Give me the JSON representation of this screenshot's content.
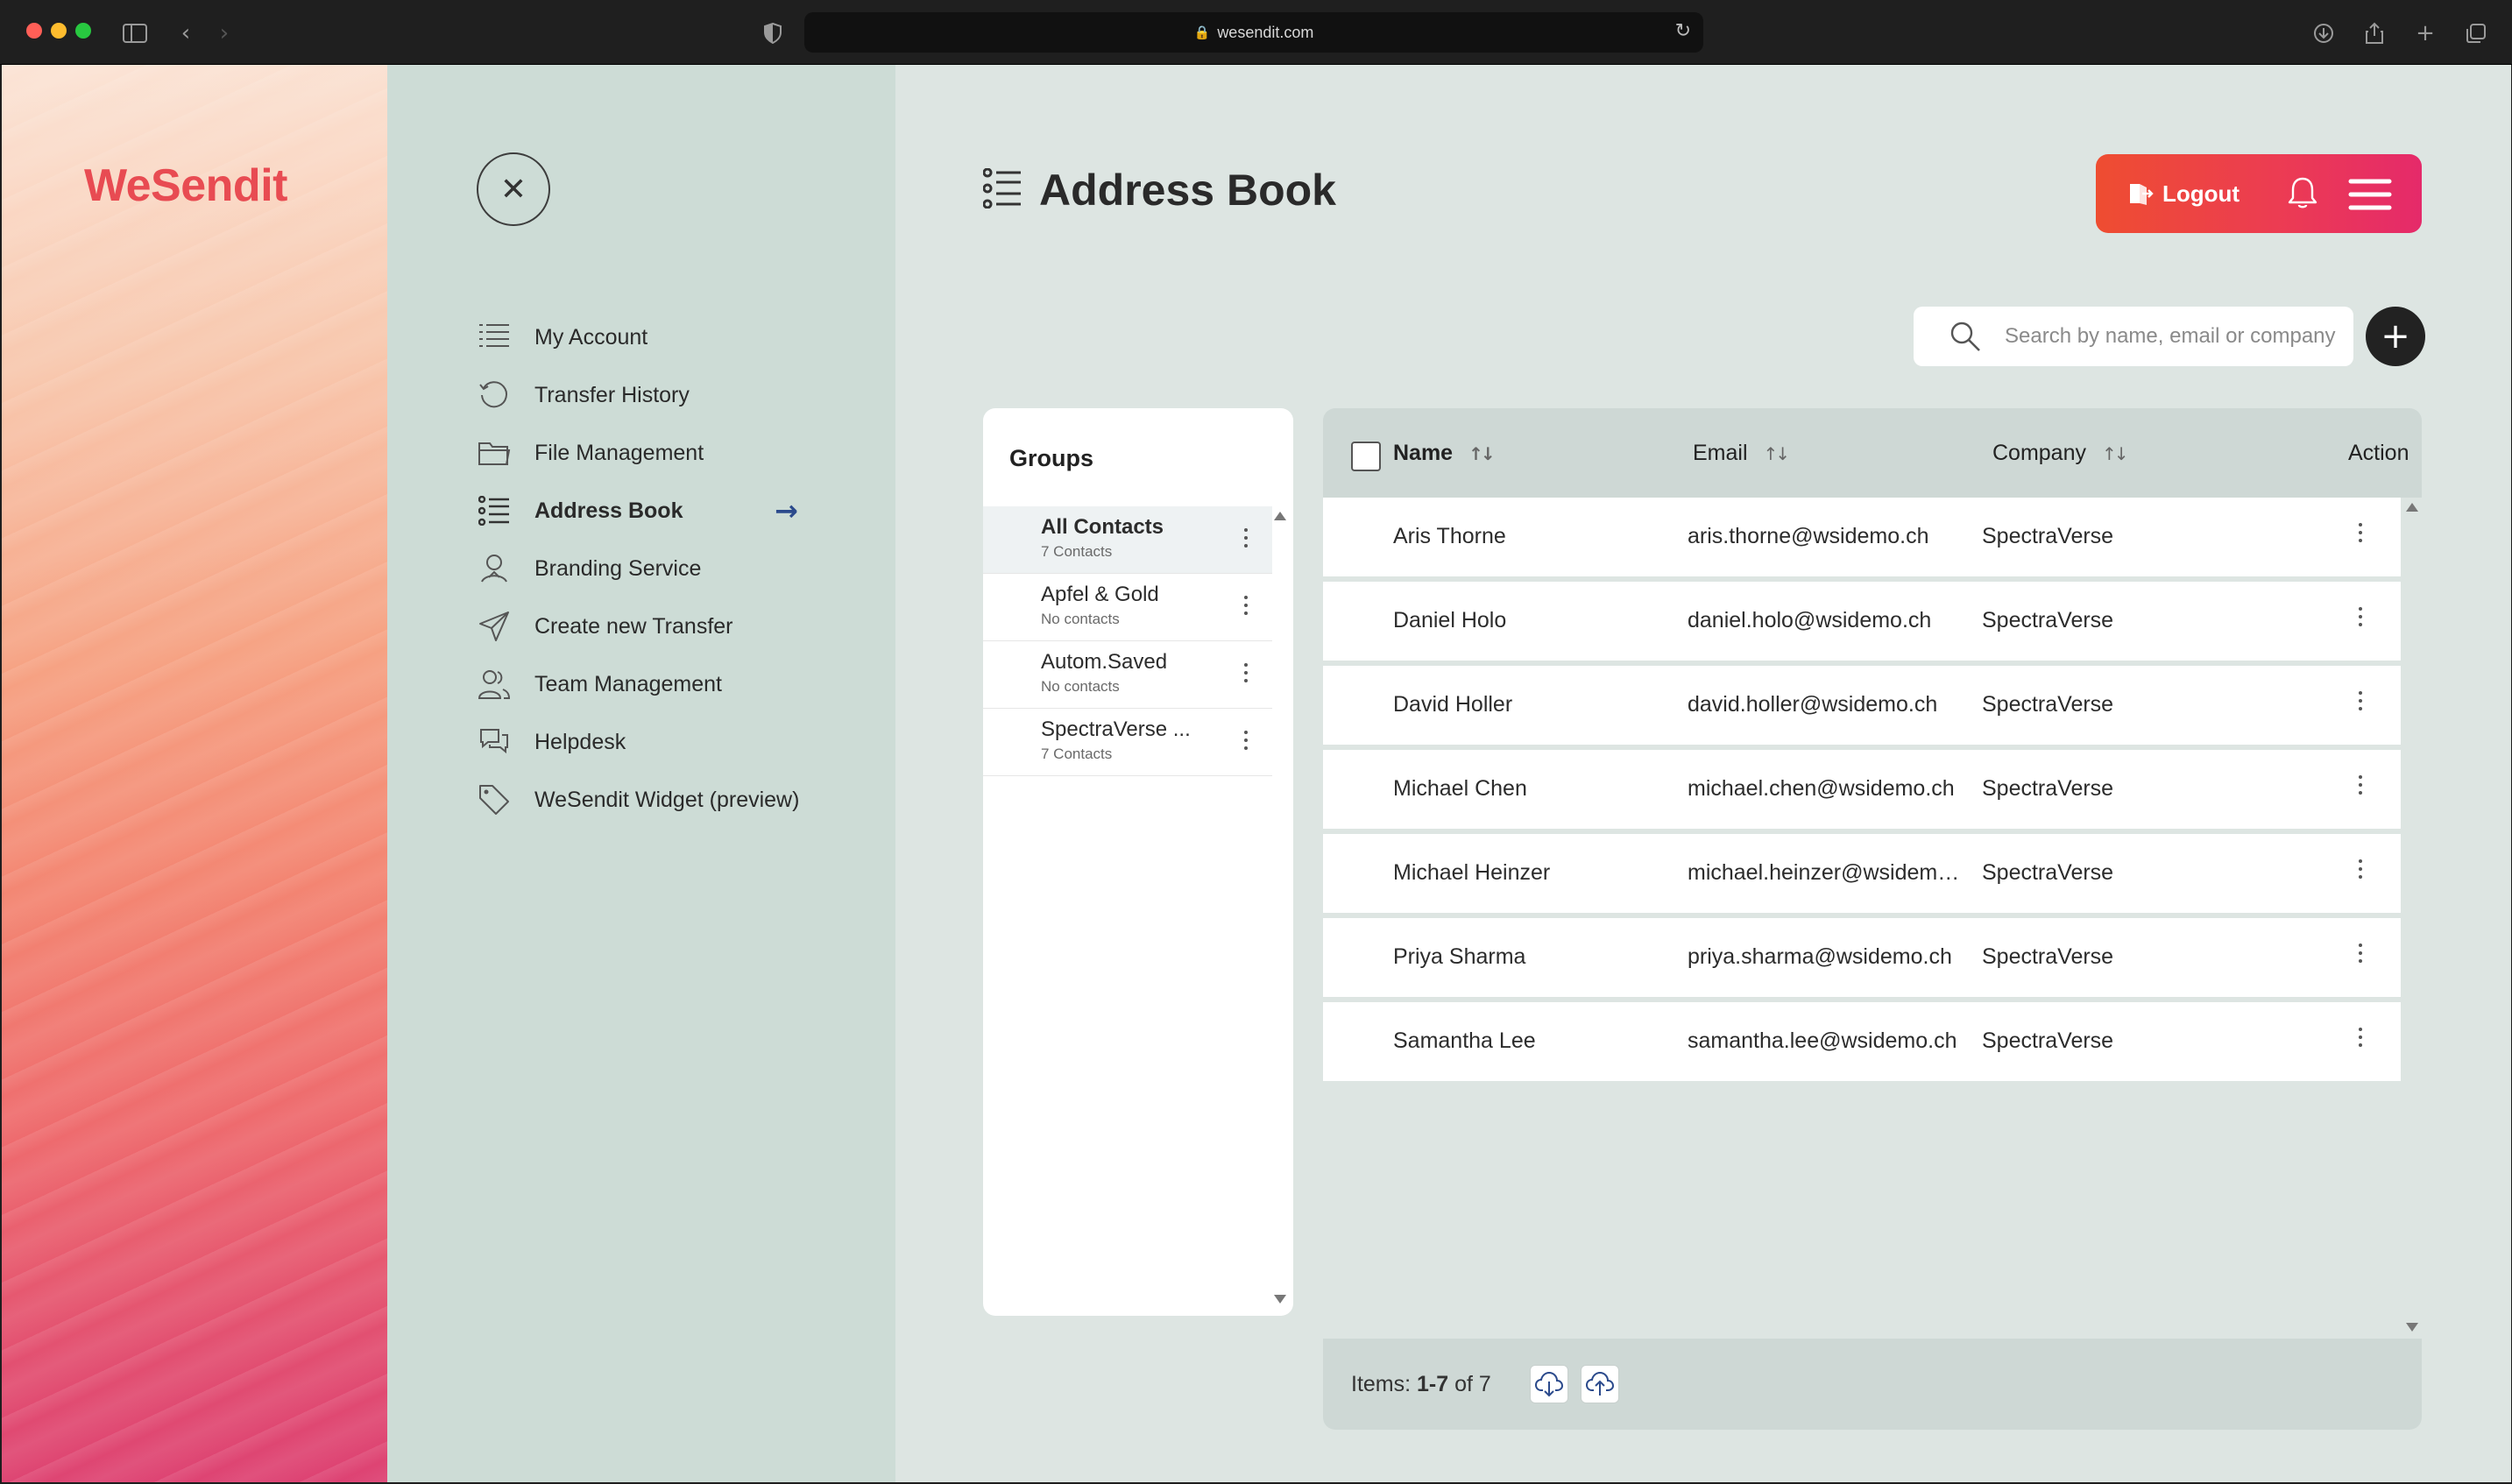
{
  "browser": {
    "url": "wesendit.com",
    "lock_icon": "lock-icon",
    "traffic_colors": [
      "#ff5f57",
      "#febc2e",
      "#28c840"
    ]
  },
  "brand": {
    "logo_text": "WeSendit",
    "logo_color": "#e84b52"
  },
  "menu": {
    "items": [
      {
        "label": "My Account",
        "icon": "list-icon"
      },
      {
        "label": "Transfer History",
        "icon": "history-icon"
      },
      {
        "label": "File Management",
        "icon": "folder-icon"
      },
      {
        "label": "Address Book",
        "icon": "address-book-icon",
        "active": true
      },
      {
        "label": "Branding Service",
        "icon": "branding-icon"
      },
      {
        "label": "Create new Transfer",
        "icon": "send-icon"
      },
      {
        "label": "Team Management",
        "icon": "team-icon"
      },
      {
        "label": "Helpdesk",
        "icon": "chat-icon"
      },
      {
        "label": "WeSendit Widget (preview)",
        "icon": "tag-icon"
      }
    ]
  },
  "header": {
    "title": "Address Book",
    "logout_label": "Logout",
    "accent_gradient": [
      "#ee4d31",
      "#e52a6a"
    ]
  },
  "search": {
    "placeholder": "Search by name, email or company"
  },
  "groups": {
    "title": "Groups",
    "items": [
      {
        "name": "All Contacts",
        "count": "7 Contacts",
        "active": true
      },
      {
        "name": "Apfel & Gold",
        "count": "No contacts"
      },
      {
        "name": "Autom.Saved",
        "count": "No contacts"
      },
      {
        "name": "SpectraVerse ...",
        "count": "7 Contacts"
      }
    ]
  },
  "table": {
    "columns": {
      "name": "Name",
      "email": "Email",
      "company": "Company",
      "action": "Action"
    },
    "rows": [
      {
        "name": "Aris Thorne",
        "email": "aris.thorne@wsidemo.ch",
        "company": "SpectraVerse"
      },
      {
        "name": "Daniel Holo",
        "email": "daniel.holo@wsidemo.ch",
        "company": "SpectraVerse"
      },
      {
        "name": "David Holler",
        "email": "david.holler@wsidemo.ch",
        "company": "SpectraVerse"
      },
      {
        "name": "Michael Chen",
        "email": "michael.chen@wsidemo.ch",
        "company": "SpectraVerse"
      },
      {
        "name": "Michael Heinzer",
        "email": "michael.heinzer@wsidemo....",
        "company": "SpectraVerse"
      },
      {
        "name": "Priya Sharma",
        "email": "priya.sharma@wsidemo.ch",
        "company": "SpectraVerse"
      },
      {
        "name": "Samantha Lee",
        "email": "samantha.lee@wsidemo.ch",
        "company": "SpectraVerse"
      }
    ]
  },
  "footer": {
    "items_prefix": "Items:",
    "items_range": "1-7",
    "items_of": "of 7"
  }
}
